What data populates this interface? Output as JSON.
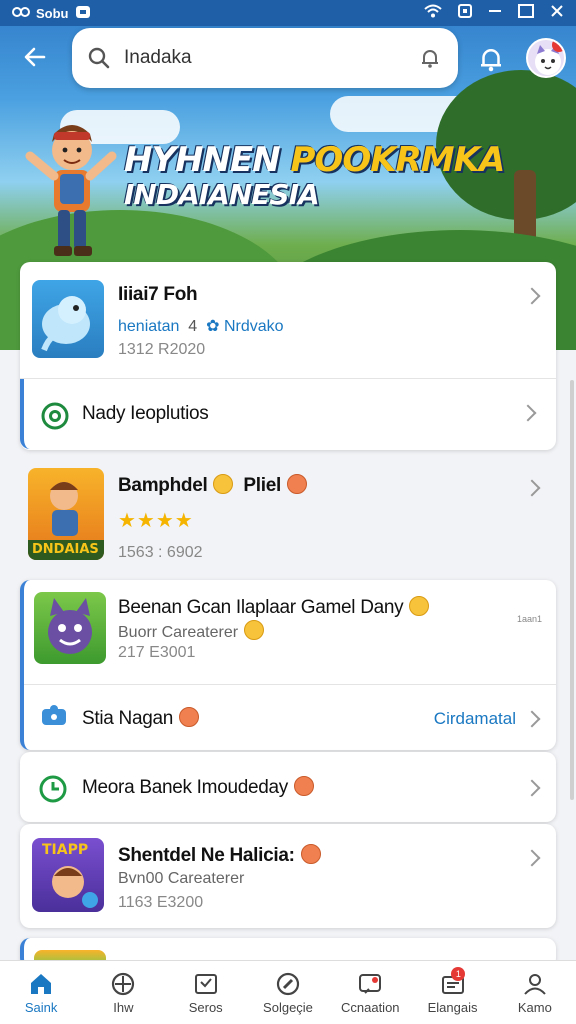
{
  "status_bar": {
    "left_text": "Sobu",
    "colors": {
      "bg": "#1f5fa8"
    }
  },
  "header": {
    "search": {
      "value": "Inadaka",
      "placeholder": "Inadaka"
    }
  },
  "banner": {
    "line1_white": "HYHNEN ",
    "line1_gold": "POOKRMKA",
    "line2": "INDAIANESIA"
  },
  "list": {
    "item1": {
      "title": "Iiiai7 Foh",
      "sub_blue": "heniatan",
      "sub_num": "4",
      "sub_blue2": "Nrdvako",
      "meta": "1312 R2020"
    },
    "item2": {
      "title": "Nady Ieoplutios"
    },
    "item3": {
      "title": "Bamphdel",
      "title2": "Pliel",
      "stars": "★★★★",
      "meta": "1563 : 6902",
      "thumb_text": "DNDAIAS"
    },
    "item4": {
      "title": "Beenan Gcan Ilaplaar Gamel Dany",
      "sub": "Buorr Careaterer",
      "meta": "217 E3001",
      "side": "1aan1"
    },
    "item5": {
      "title": "Stia Nagan",
      "action": "Cirdamatal"
    },
    "item6": {
      "title": "Meora Banek Imoudeday"
    },
    "item7": {
      "title": "Shentdel Ne Halicia:",
      "sub": "Bvn00 Careaterer",
      "meta": "1163 E3200",
      "thumb_text": "TIAPP"
    }
  },
  "bottom_nav": [
    {
      "label": "Saink",
      "icon": "home-icon",
      "active": true
    },
    {
      "label": "Ihw",
      "icon": "gamepad-icon"
    },
    {
      "label": "Seros",
      "icon": "inbox-icon"
    },
    {
      "label": "Solgeçie",
      "icon": "compass-icon"
    },
    {
      "label": "Ccnaation",
      "icon": "chat-icon"
    },
    {
      "label": "Elangais",
      "icon": "inbox-alert-icon",
      "badge": "1"
    },
    {
      "label": "Kamo",
      "icon": "profile-icon"
    }
  ],
  "accent_color": "#3b82d6"
}
